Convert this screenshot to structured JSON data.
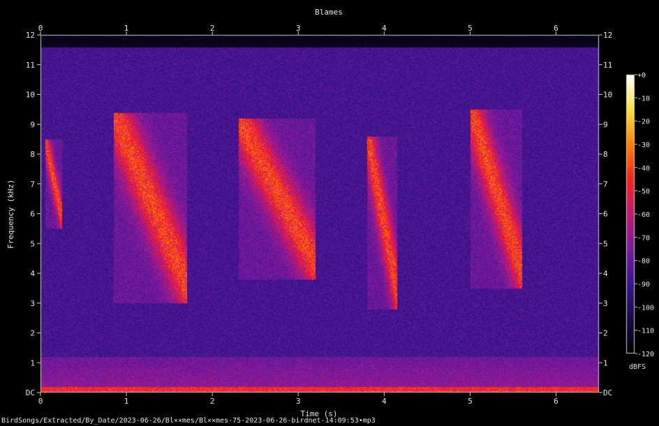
{
  "chart_data": {
    "type": "heatmap",
    "title": "Blames",
    "xlabel": "Time (s)",
    "ylabel": "Frequency (kHz)",
    "xlim": [
      0,
      6.5
    ],
    "ylim": [
      0,
      12
    ],
    "x_ticks": [
      "0",
      "1",
      "2",
      "3",
      "4",
      "5",
      "6"
    ],
    "y_ticks": [
      "DC",
      "1",
      "2",
      "3",
      "4",
      "5",
      "6",
      "7",
      "8",
      "9",
      "10",
      "11",
      "12"
    ],
    "colorbar": {
      "label": "dBFS",
      "range": [
        -120,
        0
      ],
      "ticks": [
        "+0",
        "-10",
        "-20",
        "-30",
        "-40",
        "-50",
        "-60",
        "-70",
        "-80",
        "-90",
        "-100",
        "-110",
        "-120"
      ]
    },
    "colormap": [
      "#000000",
      "#1a0a4a",
      "#3a1590",
      "#7a1aa0",
      "#c01a70",
      "#ff2020",
      "#ff8000",
      "#ffe040",
      "#ffffff"
    ],
    "content_cutoff_khz": 11.6,
    "calls": [
      {
        "start_s": 0.85,
        "end_s": 1.7,
        "low_khz": 3.0,
        "high_khz": 9.4
      },
      {
        "start_s": 2.3,
        "end_s": 3.2,
        "low_khz": 3.8,
        "high_khz": 9.2
      },
      {
        "start_s": 3.8,
        "end_s": 4.15,
        "low_khz": 2.8,
        "high_khz": 8.6
      },
      {
        "start_s": 5.0,
        "end_s": 5.6,
        "low_khz": 3.5,
        "high_khz": 9.5
      },
      {
        "start_s": 0.05,
        "end_s": 0.25,
        "low_khz": 5.5,
        "high_khz": 8.5
      }
    ]
  },
  "footer": {
    "filename": "BirdSongs/Extracted/By_Date/2023-06-26/Bl××mes/Bl××mes-75-2023-06-26-birdnet-14:09:53•mp3"
  }
}
